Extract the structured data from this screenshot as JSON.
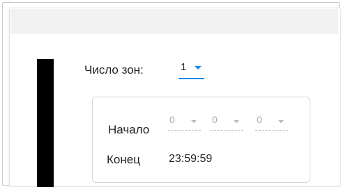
{
  "zones": {
    "label": "Число зон:",
    "selected": "1"
  },
  "zone": {
    "start_label": "Начало",
    "start_hours": "0",
    "start_minutes": "0",
    "start_seconds": "0",
    "end_label": "Конец",
    "end_value": "23:59:59"
  },
  "colors": {
    "accent": "#1e88e5",
    "header_bar": "#f2f2f2",
    "side_bar": "#000000"
  },
  "icons": {
    "dropdown": "chevron-down-icon"
  }
}
